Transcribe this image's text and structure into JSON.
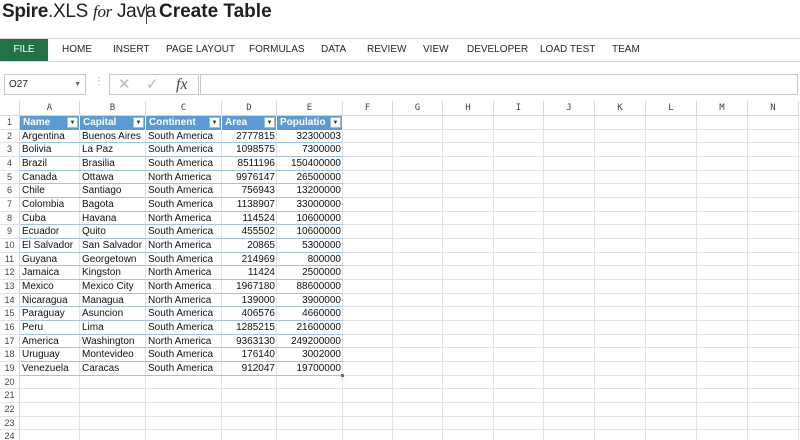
{
  "header": {
    "brand_spire": "Spire",
    "brand_xls": ".XLS",
    "brand_for": "for",
    "brand_java": "Java",
    "page_title": "Create Table"
  },
  "ribbon": {
    "tabs": [
      "FILE",
      "HOME",
      "INSERT",
      "PAGE LAYOUT",
      "FORMULAS",
      "DATA",
      "REVIEW",
      "VIEW",
      "DEVELOPER",
      "LOAD TEST",
      "TEAM"
    ]
  },
  "formula_bar": {
    "name_box": "O27",
    "dropdown_icon": "chevron-down-icon",
    "cancel_icon": "close-icon",
    "enter_icon": "check-icon",
    "fx_label": "fx",
    "formula_value": ""
  },
  "sheet": {
    "column_letters": [
      "A",
      "B",
      "C",
      "D",
      "E",
      "F",
      "G",
      "H",
      "I",
      "J",
      "K",
      "L",
      "M",
      "N"
    ],
    "row_numbers": [
      "1",
      "2",
      "3",
      "4",
      "5",
      "6",
      "7",
      "8",
      "9",
      "10",
      "11",
      "12",
      "13",
      "14",
      "15",
      "16",
      "17",
      "18",
      "19",
      "20",
      "21",
      "22",
      "23",
      "24"
    ],
    "table": {
      "headers": [
        "Name",
        "Capital",
        "Continent",
        "Area",
        "Populatio"
      ],
      "filter_icon": "filter-dropdown-icon",
      "header_color": "#5b9bd5",
      "rows": [
        [
          "Argentina",
          "Buenos Aires",
          "South America",
          "2777815",
          "32300003"
        ],
        [
          "Bolivia",
          "La Paz",
          "South America",
          "1098575",
          "7300000"
        ],
        [
          "Brazil",
          "Brasilia",
          "South America",
          "8511196",
          "150400000"
        ],
        [
          "Canada",
          "Ottawa",
          "North America",
          "9976147",
          "26500000"
        ],
        [
          "Chile",
          "Santiago",
          "South America",
          "756943",
          "13200000"
        ],
        [
          "Colombia",
          "Bagota",
          "South America",
          "1138907",
          "33000000"
        ],
        [
          "Cuba",
          "Havana",
          "North America",
          "114524",
          "10600000"
        ],
        [
          "Ecuador",
          "Quito",
          "South America",
          "455502",
          "10600000"
        ],
        [
          "El Salvador",
          "San Salvador",
          "North America",
          "20865",
          "5300000"
        ],
        [
          "Guyana",
          "Georgetown",
          "South America",
          "214969",
          "800000"
        ],
        [
          "Jamaica",
          "Kingston",
          "North America",
          "11424",
          "2500000"
        ],
        [
          "Mexico",
          "Mexico City",
          "North America",
          "1967180",
          "88600000"
        ],
        [
          "Nicaragua",
          "Managua",
          "North America",
          "139000",
          "3900000"
        ],
        [
          "Paraguay",
          "Asuncion",
          "South America",
          "406576",
          "4660000"
        ],
        [
          "Peru",
          "Lima",
          "South America",
          "1285215",
          "21600000"
        ],
        [
          "America",
          "Washington",
          "North America",
          "9363130",
          "249200000"
        ],
        [
          "Uruguay",
          "Montevideo",
          "South America",
          "176140",
          "3002000"
        ],
        [
          "Venezuela",
          "Caracas",
          "South America",
          "912047",
          "19700000"
        ]
      ]
    }
  }
}
